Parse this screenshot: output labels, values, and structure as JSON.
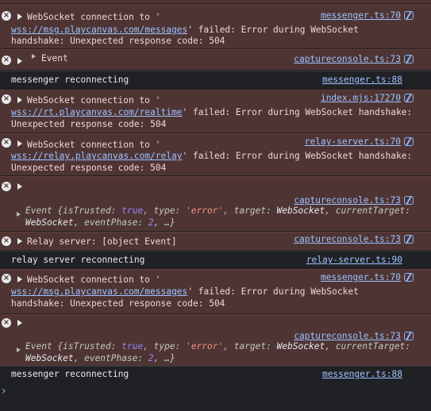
{
  "entries": [
    {
      "kind": "error",
      "prefix": "WebSocket connection to '",
      "url": "wss://msg.playcanvas.com/messages",
      "suffix1": "' failed: Error during WebSocket",
      "line3": "handshake: Unexpected response code: 504",
      "source": "messenger.ts:70"
    },
    {
      "kind": "error",
      "text": "Event",
      "source": "captureconsole.ts:73"
    },
    {
      "kind": "log",
      "text": "messenger reconnecting",
      "source": "messenger.ts:88"
    },
    {
      "kind": "error",
      "prefix": "WebSocket connection to '",
      "url": "wss://rt.playcanvas.com/realtime",
      "suffix1": "' failed: Error during WebSocket handshake:",
      "line3": "Unexpected response code: 504",
      "source": "index.mjs:17270"
    },
    {
      "kind": "error",
      "prefix": "WebSocket connection to '",
      "url": "wss://relay.playcanvas.com/relay",
      "suffix1": "' failed: Error during WebSocket handshake:",
      "line3": "Unexpected response code: 504",
      "source": "relay-server.ts:70"
    },
    {
      "kind": "error-obj",
      "source": "captureconsole.ts:73",
      "obj": {
        "head": "Event {",
        "k1": "isTrusted: ",
        "v1": "true",
        "k2": ", type: ",
        "v2": "'error'",
        "k3": ", target: ",
        "v3": "WebSocket",
        "k4": ", currentTarget:",
        "l2a": "WebSocket",
        "k5": ", eventPhase: ",
        "v5": "2",
        "tail": ", …}"
      }
    },
    {
      "kind": "error",
      "text": "Relay server: [object Event]",
      "source": "captureconsole.ts:73"
    },
    {
      "kind": "log",
      "text": "relay server reconnecting",
      "source": "relay-server.ts:90"
    },
    {
      "kind": "error",
      "prefix": "WebSocket connection to '",
      "url": "wss://msg.playcanvas.com/messages",
      "suffix1": "' failed: Error during WebSocket",
      "line3": "handshake: Unexpected response code: 504",
      "source": "messenger.ts:70"
    },
    {
      "kind": "error-obj",
      "source": "captureconsole.ts:73",
      "obj": {
        "head": "Event {",
        "k1": "isTrusted: ",
        "v1": "true",
        "k2": ", type: ",
        "v2": "'error'",
        "k3": ", target: ",
        "v3": "WebSocket",
        "k4": ", currentTarget:",
        "l2a": "WebSocket",
        "k5": ", eventPhase: ",
        "v5": "2",
        "tail": ", …}"
      }
    },
    {
      "kind": "log",
      "text": "messenger reconnecting",
      "source": "messenger.ts:88"
    }
  ],
  "prompt_symbol": "›",
  "error_icon_glyph": "×",
  "colors": {
    "error_bg": "#4e3534",
    "link": "#9ec1ff",
    "bg": "#202124"
  }
}
